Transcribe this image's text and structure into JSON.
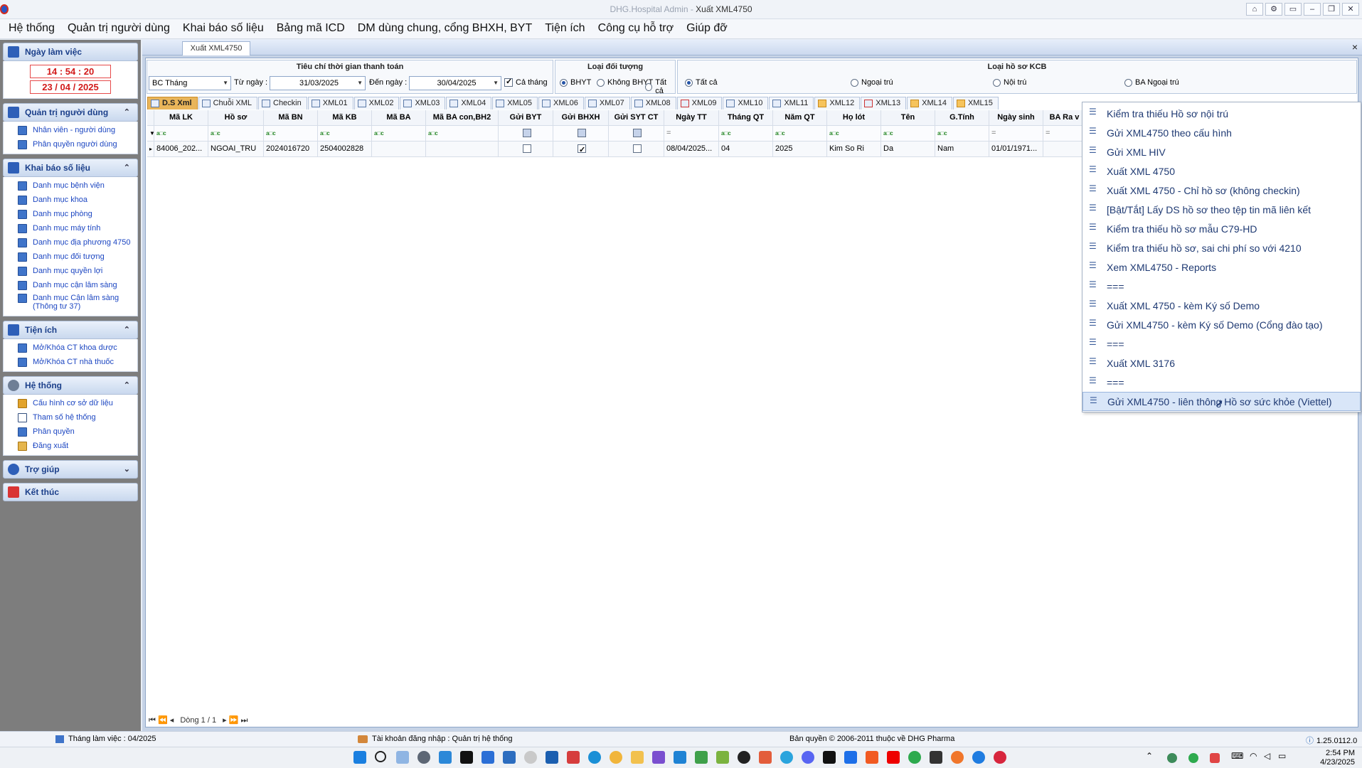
{
  "window": {
    "title_prefix": "DHG.Hospital Admin - ",
    "title_main": "Xuất XML4750"
  },
  "menu": [
    "Hệ thống",
    "Quản trị người dùng",
    "Khai báo số liệu",
    "Bảng mã ICD",
    "DM dùng chung, cổng BHXH, BYT",
    "Tiện ích",
    "Công cụ hỗ trợ",
    "Giúp đỡ"
  ],
  "sidebar": {
    "workday": {
      "title": "Ngày làm việc",
      "time": "14 : 54 : 20",
      "date": "23 / 04 / 2025"
    },
    "user_admin": {
      "title": "Quản trị người dùng",
      "items": [
        "Nhân viên - người dùng",
        "Phân quyền người dùng"
      ]
    },
    "data_decl": {
      "title": "Khai báo số liệu",
      "items": [
        "Danh mục bệnh viện",
        "Danh mục khoa",
        "Danh mục phòng",
        "Danh mục máy tính",
        "Danh mục địa phương 4750",
        "Danh mục đối tượng",
        "Danh mục quyền lợi",
        "Danh mục cận lâm sàng",
        "Danh mục Cận lâm sàng (Thông tư 37)"
      ]
    },
    "utilities": {
      "title": "Tiện ích",
      "items": [
        "Mở/Khóa CT khoa dược",
        "Mở/Khóa CT nhà thuốc"
      ]
    },
    "system": {
      "title": "Hệ thống",
      "items": [
        "Cấu hình cơ sở dữ liệu",
        "Tham số hệ thống",
        "Phân quyền",
        "Đăng xuất"
      ]
    },
    "help": {
      "title": "Trợ giúp"
    },
    "finish": {
      "title": "Kết thúc"
    }
  },
  "doc_tab": {
    "label": "Xuất XML4750",
    "close": "×"
  },
  "filters": {
    "time_panel": {
      "title": "Tiêu chí thời gian thanh toán",
      "period": "BC Tháng",
      "from_label": "Từ ngày :",
      "from_value": "31/03/2025",
      "to_label": "Đến ngày :",
      "to_value": "30/04/2025",
      "whole_month": "Cả tháng"
    },
    "object_panel": {
      "title": "Loại đối tượng",
      "options": [
        "BHYT",
        "Không BHYT",
        "Tất cả"
      ],
      "selected": "BHYT"
    },
    "record_panel": {
      "title": "Loại hồ sơ KCB",
      "options": [
        "Tất cả",
        "Ngoại trú",
        "Nội trú",
        "BA Ngoại trú"
      ],
      "selected": "Tất cả"
    }
  },
  "data_tabs": [
    "D.S Xml",
    "Chuỗi XML",
    "Checkin",
    "XML01",
    "XML02",
    "XML03",
    "XML04",
    "XML05",
    "XML06",
    "XML07",
    "XML08",
    "XML09",
    "XML10",
    "XML11",
    "XML12",
    "XML13",
    "XML14",
    "XML15"
  ],
  "grid": {
    "columns": [
      "Mã LK",
      "Hồ sơ",
      "Mã BN",
      "Mã KB",
      "Mã BA",
      "Mã BA con,BH2",
      "Gửi BYT",
      "Gửi BHXH",
      "Gửi SYT CT",
      "Ngày TT",
      "Tháng QT",
      "Năm QT",
      "Họ lót",
      "Tên",
      "G.Tính",
      "Ngày sinh",
      "BA Ra v"
    ],
    "filter_symbol": "a□c",
    "filter_eq": "=",
    "rows": [
      {
        "ma_lk": "84006_202...",
        "ho_so": "NGOAI_TRU",
        "ma_bn": "2024016720",
        "ma_kb": "2504002828",
        "ma_ba": "",
        "ma_ba_con": "",
        "gui_byt": false,
        "gui_bhxh": true,
        "gui_syt": false,
        "ngay_tt": "08/04/2025...",
        "thang_qt": "04",
        "nam_qt": "2025",
        "ho_lot": "Kim So Ri",
        "ten": "Da",
        "gioi_tinh": "Nam",
        "ngay_sinh": "01/01/1971..."
      }
    ],
    "pager": "Dòng 1 / 1"
  },
  "context_menu": {
    "items": [
      "Kiểm tra thiếu Hồ sơ nội trú",
      "Gửi XML4750 theo cấu hình",
      "Gửi XML HIV",
      "Xuất XML 4750",
      "Xuất XML 4750 - Chỉ hồ sơ (không checkin)",
      "[Bật/Tắt] Lấy DS hồ sơ theo tệp tin mã liên kết",
      "Kiểm tra thiếu hồ sơ mẫu C79-HD",
      "Kiểm tra thiếu hồ sơ, sai chi phí so với 4210",
      "Xem XML4750 - Reports",
      "===",
      "Xuất XML 4750 - kèm Ký số Demo",
      "Gửi XML4750 - kèm Ký số Demo (Cổng đào tạo)",
      "===",
      "Xuất XML 3176",
      "===",
      "Gửi XML4750 - liên thông Hồ sơ sức khỏe (Viettel)"
    ],
    "hovered_index": 15
  },
  "statusbar": {
    "month": "Tháng làm việc : 04/2025",
    "account": "Tài khoản đăng nhập : Quản trị hệ thống",
    "copyright": "Bản quyền © 2006-2011 thuộc về DHG Pharma",
    "version": "1.25.0112.0"
  },
  "taskbar": {
    "time": "2:54 PM",
    "date": "4/23/2025"
  }
}
